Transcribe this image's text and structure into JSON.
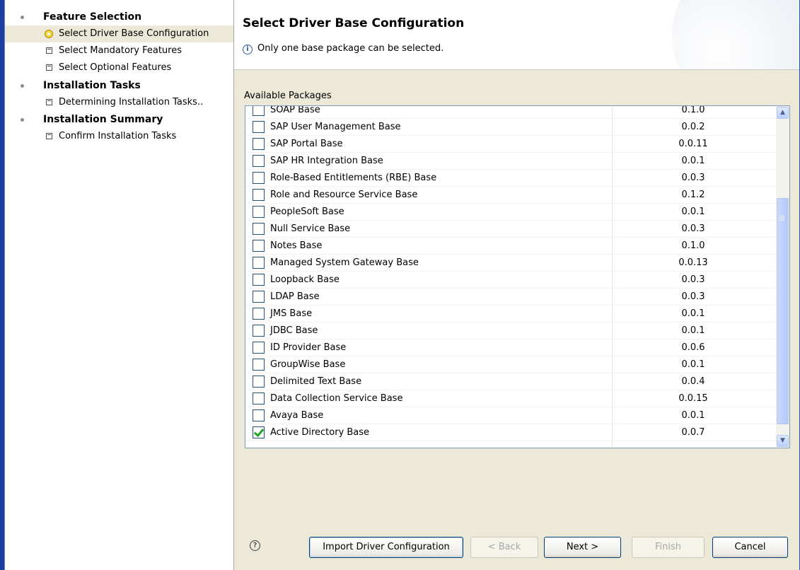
{
  "nav": {
    "groups": [
      {
        "title": "Feature Selection",
        "items": [
          {
            "label": "Select Driver Base Configuration",
            "selected": true
          },
          {
            "label": "Select Mandatory Features"
          },
          {
            "label": "Select Optional Features"
          }
        ]
      },
      {
        "title": "Installation Tasks",
        "items": [
          {
            "label": "Determining Installation Tasks.."
          }
        ]
      },
      {
        "title": "Installation Summary",
        "items": [
          {
            "label": "Confirm Installation Tasks"
          }
        ]
      }
    ]
  },
  "header": {
    "title": "Select Driver Base Configuration",
    "info_icon": "info-icon",
    "info_text": "Only one base package can be selected."
  },
  "packages": {
    "label": "Available Packages",
    "rows": [
      {
        "name": "SOAP Base",
        "version": "0.1.0",
        "checked": false
      },
      {
        "name": "SAP User Management Base",
        "version": "0.0.2",
        "checked": false
      },
      {
        "name": "SAP Portal Base",
        "version": "0.0.11",
        "checked": false
      },
      {
        "name": "SAP HR Integration Base",
        "version": "0.0.1",
        "checked": false
      },
      {
        "name": "Role-Based Entitlements (RBE) Base",
        "version": "0.0.3",
        "checked": false
      },
      {
        "name": "Role and Resource Service Base",
        "version": "0.1.2",
        "checked": false
      },
      {
        "name": "PeopleSoft Base",
        "version": "0.0.1",
        "checked": false
      },
      {
        "name": "Null Service Base",
        "version": "0.0.3",
        "checked": false
      },
      {
        "name": "Notes Base",
        "version": "0.1.0",
        "checked": false
      },
      {
        "name": "Managed System Gateway Base",
        "version": "0.0.13",
        "checked": false
      },
      {
        "name": "Loopback Base",
        "version": "0.0.3",
        "checked": false
      },
      {
        "name": "LDAP Base",
        "version": "0.0.3",
        "checked": false
      },
      {
        "name": "JMS Base",
        "version": "0.0.1",
        "checked": false
      },
      {
        "name": "JDBC Base",
        "version": "0.0.1",
        "checked": false
      },
      {
        "name": "ID Provider Base",
        "version": "0.0.6",
        "checked": false
      },
      {
        "name": "GroupWise Base",
        "version": "0.0.1",
        "checked": false
      },
      {
        "name": "Delimited Text Base",
        "version": "0.0.4",
        "checked": false
      },
      {
        "name": "Data Collection Service Base",
        "version": "0.0.15",
        "checked": false
      },
      {
        "name": "Avaya Base",
        "version": "0.0.1",
        "checked": false
      },
      {
        "name": "Active Directory Base",
        "version": "0.0.7",
        "checked": true
      }
    ]
  },
  "footer": {
    "help_icon": "help-icon",
    "import_label": "Import Driver Configuration",
    "back_label": "< Back",
    "next_label": "Next >",
    "finish_label": "Finish",
    "cancel_label": "Cancel"
  },
  "colors": {
    "window_border": "#1c3fa0",
    "panel_bg": "#ece9d8",
    "check_green": "#21a121"
  }
}
